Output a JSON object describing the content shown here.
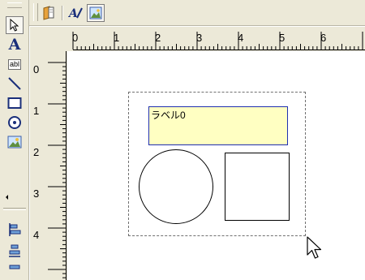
{
  "hruler": {
    "numbers": [
      "0",
      "1",
      "2",
      "3",
      "4",
      "5",
      "6"
    ]
  },
  "vruler": {
    "numbers": [
      "0",
      "1",
      "2",
      "3",
      "4"
    ]
  },
  "canvas": {
    "label_text": "ラベル0"
  },
  "icons": {
    "left_toolbar": [
      "pointer-arrow-icon",
      "text-tool-icon",
      "label-field-icon",
      "line-tool-icon",
      "rectangle-tool-icon",
      "ellipse-tool-icon",
      "image-tool-icon",
      "align-left-icon",
      "align-center-icon"
    ],
    "top_toolbar": [
      "open-document-icon",
      "font-format-icon",
      "picture-frame-icon"
    ]
  },
  "colors": {
    "toolbar_bg": "#ece9d8",
    "label_fill": "#ffffc2",
    "label_border": "#1f2fb0"
  }
}
